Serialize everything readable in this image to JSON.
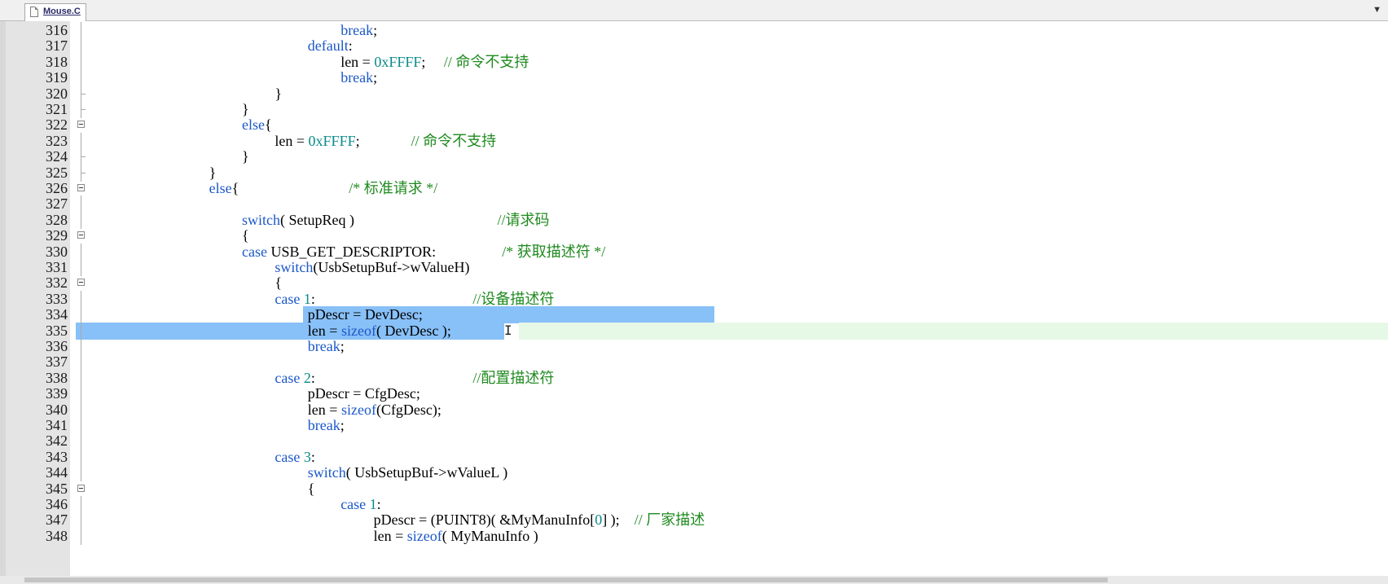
{
  "tab": {
    "filename": "Mouse.C",
    "icon": "file-icon",
    "dropdown_icon": "chevron-down-icon"
  },
  "lines": [
    {
      "num": "316",
      "indent": 8,
      "fold": "line",
      "tokens": [
        [
          "kw",
          "break"
        ],
        [
          "t",
          ";"
        ]
      ]
    },
    {
      "num": "317",
      "indent": 7,
      "fold": "line",
      "tokens": [
        [
          "kw",
          "default"
        ],
        [
          "t",
          ":"
        ]
      ]
    },
    {
      "num": "318",
      "indent": 8,
      "fold": "line",
      "tokens": [
        [
          "t",
          "len = "
        ],
        [
          "num",
          "0xFFFF"
        ],
        [
          "t",
          ";     "
        ],
        [
          "cmt",
          "// 命令不支持"
        ]
      ]
    },
    {
      "num": "319",
      "indent": 8,
      "fold": "line",
      "tokens": [
        [
          "kw",
          "break"
        ],
        [
          "t",
          ";"
        ]
      ]
    },
    {
      "num": "320",
      "indent": 6,
      "fold": "end",
      "tokens": [
        [
          "t",
          "}"
        ]
      ]
    },
    {
      "num": "321",
      "indent": 5,
      "fold": "end",
      "tokens": [
        [
          "t",
          "}"
        ]
      ]
    },
    {
      "num": "322",
      "indent": 5,
      "fold": "box",
      "tokens": [
        [
          "kw",
          "else"
        ],
        [
          "t",
          "{"
        ]
      ]
    },
    {
      "num": "323",
      "indent": 6,
      "fold": "line",
      "tokens": [
        [
          "t",
          "len = "
        ],
        [
          "num",
          "0xFFFF"
        ],
        [
          "t",
          ";              "
        ],
        [
          "cmt",
          "// 命令不支持"
        ]
      ]
    },
    {
      "num": "324",
      "indent": 5,
      "fold": "end",
      "tokens": [
        [
          "t",
          "}"
        ]
      ]
    },
    {
      "num": "325",
      "indent": 4,
      "fold": "end",
      "tokens": [
        [
          "t",
          "}"
        ]
      ]
    },
    {
      "num": "326",
      "indent": 4,
      "fold": "box",
      "tokens": [
        [
          "kw",
          "else"
        ],
        [
          "t",
          "{                              "
        ],
        [
          "cmt",
          "/* 标准请求 */"
        ]
      ]
    },
    {
      "num": "327",
      "indent": 0,
      "fold": "line",
      "tokens": []
    },
    {
      "num": "328",
      "indent": 5,
      "fold": "line",
      "tokens": [
        [
          "kw",
          "switch"
        ],
        [
          "t",
          "( SetupReq )                                       "
        ],
        [
          "cmt",
          "//请求码"
        ]
      ]
    },
    {
      "num": "329",
      "indent": 5,
      "fold": "box",
      "tokens": [
        [
          "t",
          "{"
        ]
      ]
    },
    {
      "num": "330",
      "indent": 5,
      "fold": "line",
      "tokens": [
        [
          "kw",
          "case"
        ],
        [
          "t",
          " USB_GET_DESCRIPTOR:                  "
        ],
        [
          "cmt",
          "/* 获取描述符 */"
        ]
      ]
    },
    {
      "num": "331",
      "indent": 6,
      "fold": "line",
      "tokens": [
        [
          "kw",
          "switch"
        ],
        [
          "t",
          "(UsbSetupBuf->wValueH)"
        ]
      ]
    },
    {
      "num": "332",
      "indent": 6,
      "fold": "box",
      "tokens": [
        [
          "t",
          "{"
        ]
      ]
    },
    {
      "num": "333",
      "indent": 6,
      "fold": "line",
      "tokens": [
        [
          "kw",
          "case"
        ],
        [
          "t",
          " "
        ],
        [
          "num",
          "1"
        ],
        [
          "t",
          ":                                           "
        ],
        [
          "cmt",
          "//设备描述符"
        ]
      ]
    },
    {
      "num": "334",
      "indent": 7,
      "fold": "line",
      "sel": [
        365,
        870
      ],
      "tokens": [
        [
          "t",
          "pDescr = DevDesc;"
        ]
      ]
    },
    {
      "num": "335",
      "indent": 7,
      "fold": "line",
      "caret": true,
      "sel": [
        86,
        612
      ],
      "tokens": [
        [
          "t",
          "len = "
        ],
        [
          "kw",
          "sizeof"
        ],
        [
          "t",
          "( DevDesc );"
        ]
      ]
    },
    {
      "num": "336",
      "indent": 7,
      "fold": "line",
      "tokens": [
        [
          "kw",
          "break"
        ],
        [
          "t",
          ";"
        ]
      ]
    },
    {
      "num": "337",
      "indent": 0,
      "fold": "line",
      "tokens": []
    },
    {
      "num": "338",
      "indent": 6,
      "fold": "line",
      "tokens": [
        [
          "kw",
          "case"
        ],
        [
          "t",
          " "
        ],
        [
          "num",
          "2"
        ],
        [
          "t",
          ":                                           "
        ],
        [
          "cmt",
          "//配置描述符"
        ]
      ]
    },
    {
      "num": "339",
      "indent": 7,
      "fold": "line",
      "tokens": [
        [
          "t",
          "pDescr = CfgDesc;"
        ]
      ]
    },
    {
      "num": "340",
      "indent": 7,
      "fold": "line",
      "tokens": [
        [
          "t",
          "len = "
        ],
        [
          "kw",
          "sizeof"
        ],
        [
          "t",
          "(CfgDesc);"
        ]
      ]
    },
    {
      "num": "341",
      "indent": 7,
      "fold": "line",
      "tokens": [
        [
          "kw",
          "break"
        ],
        [
          "t",
          ";"
        ]
      ]
    },
    {
      "num": "342",
      "indent": 0,
      "fold": "line",
      "tokens": []
    },
    {
      "num": "343",
      "indent": 6,
      "fold": "line",
      "tokens": [
        [
          "kw",
          "case"
        ],
        [
          "t",
          " "
        ],
        [
          "num",
          "3"
        ],
        [
          "t",
          ":"
        ]
      ]
    },
    {
      "num": "344",
      "indent": 7,
      "fold": "line",
      "tokens": [
        [
          "kw",
          "switch"
        ],
        [
          "t",
          "( UsbSetupBuf->wValueL )"
        ]
      ]
    },
    {
      "num": "345",
      "indent": 7,
      "fold": "box",
      "tokens": [
        [
          "t",
          "{"
        ]
      ]
    },
    {
      "num": "346",
      "indent": 8,
      "fold": "line",
      "tokens": [
        [
          "kw",
          "case"
        ],
        [
          "t",
          " "
        ],
        [
          "num",
          "1"
        ],
        [
          "t",
          ":"
        ]
      ]
    },
    {
      "num": "347",
      "indent": 9,
      "fold": "line",
      "tokens": [
        [
          "t",
          "pDescr = (PUINT8)( &MyManuInfo["
        ],
        [
          "num",
          "0"
        ],
        [
          "t",
          "] );    "
        ],
        [
          "cmt",
          "// 厂家描述"
        ]
      ]
    },
    {
      "num": "348",
      "indent": 9,
      "fold": "line",
      "tokens": [
        [
          "t",
          "len = "
        ],
        [
          "kw",
          "sizeof"
        ],
        [
          "t",
          "( MyManuInfo )"
        ]
      ]
    }
  ]
}
